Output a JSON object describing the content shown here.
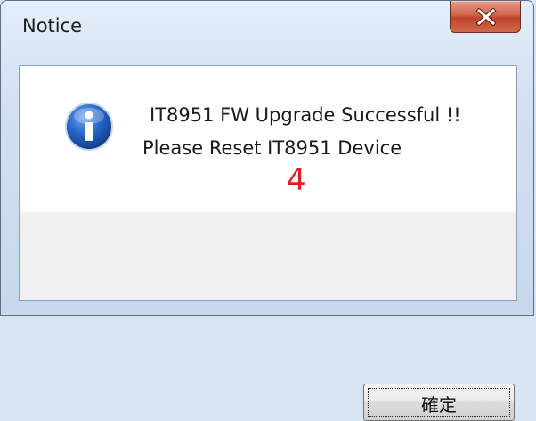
{
  "window": {
    "title": "Notice",
    "close_icon": "close-x-icon"
  },
  "message": {
    "icon": "info-icon",
    "line1": "IT8951 FW Upgrade Successful !!",
    "line2": "Please Reset IT8951 Device"
  },
  "annotation": {
    "text": "4",
    "color": "#e02020"
  },
  "buttons": {
    "ok_label": "確定"
  },
  "colors": {
    "close_button": "#c7432a",
    "info_icon_blue": "#1f5fbf"
  }
}
